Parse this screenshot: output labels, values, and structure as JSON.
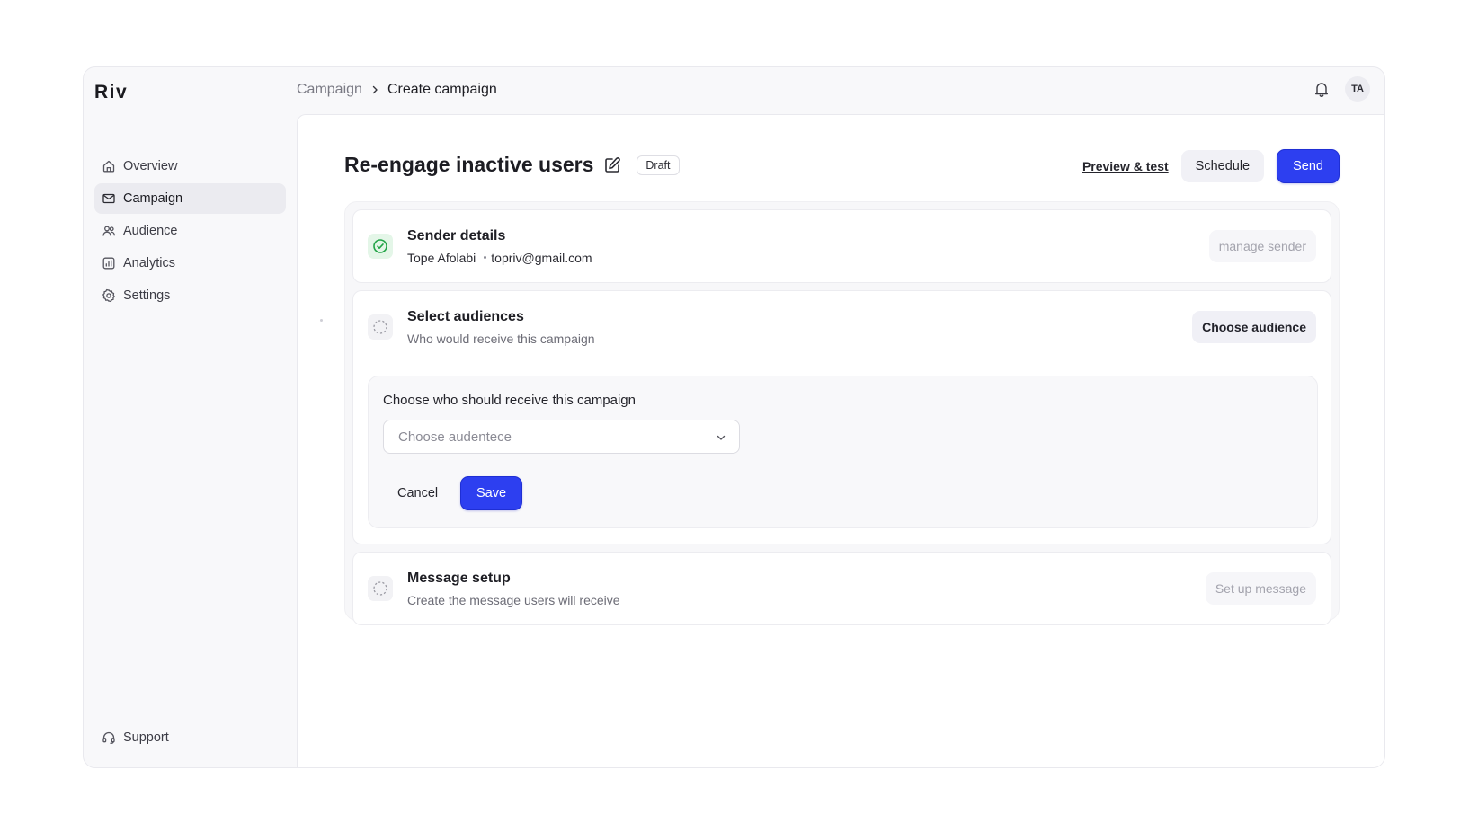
{
  "app": {
    "brand": "Riv"
  },
  "sidebar": {
    "items": [
      {
        "label": "Overview",
        "icon": "home-icon"
      },
      {
        "label": "Campaign",
        "icon": "mail-icon",
        "active": true
      },
      {
        "label": "Audience",
        "icon": "users-icon"
      },
      {
        "label": "Analytics",
        "icon": "chart-icon"
      },
      {
        "label": "Settings",
        "icon": "gear-icon"
      }
    ],
    "support_label": "Support"
  },
  "topbar": {
    "breadcrumb_parent": "Campaign",
    "breadcrumb_current": "Create campaign",
    "avatar_initials": "TA"
  },
  "page": {
    "title": "Re-engage inactive users",
    "status_badge": "Draft",
    "preview_label": "Preview & test",
    "schedule_label": "Schedule",
    "send_label": "Send"
  },
  "steps": {
    "sender": {
      "title": "Sender details",
      "name": "Tope Afolabi",
      "email": "topriv@gmail.com",
      "action_label": "manage sender",
      "status": "complete"
    },
    "audiences": {
      "title": "Select audiences",
      "subtitle": "Who would receive this campaign",
      "action_label": "Choose audience",
      "status": "in-progress",
      "panel_label": "Choose who should receive this campaign",
      "select_placeholder": "Choose audentece",
      "cancel_label": "Cancel",
      "save_label": "Save"
    },
    "message": {
      "title": "Message setup",
      "subtitle": "Create the message users will receive",
      "action_label": "Set up message",
      "status": "pending"
    }
  },
  "colors": {
    "primary": "#2d3ff0",
    "success": "#22a447",
    "sidebar_active_bg": "#ebebf0"
  }
}
